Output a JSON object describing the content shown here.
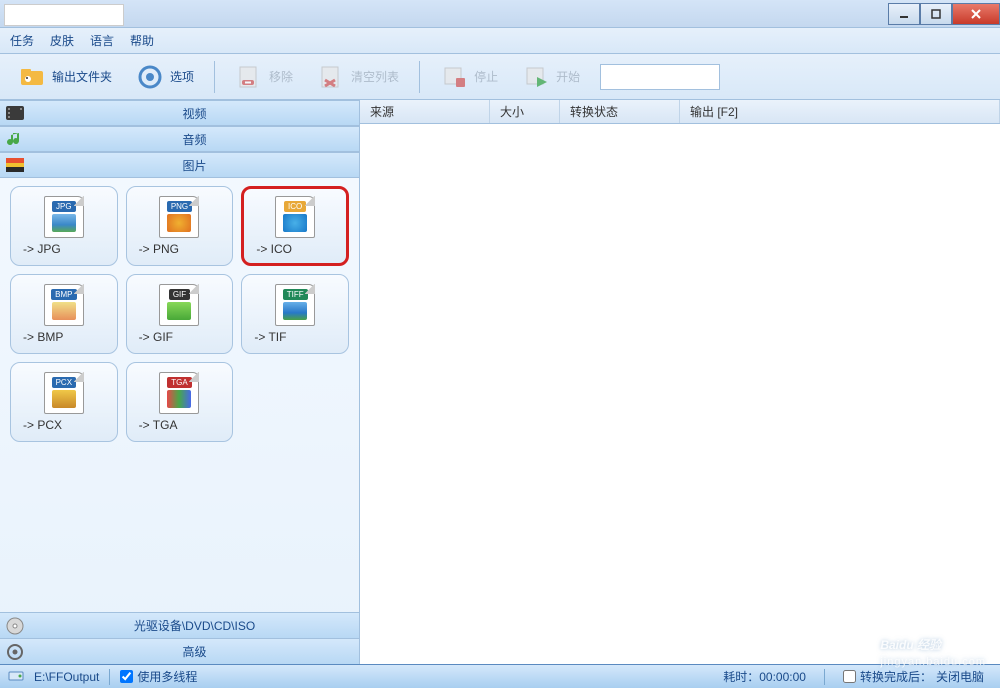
{
  "window": {
    "title": ""
  },
  "menu": {
    "task": "任务",
    "skin": "皮肤",
    "language": "语言",
    "help": "帮助"
  },
  "toolbar": {
    "output_folder": "输出文件夹",
    "options": "选项",
    "remove": "移除",
    "clear_list": "清空列表",
    "stop": "停止",
    "start": "开始"
  },
  "categories": {
    "video": "视频",
    "audio": "音频",
    "image": "图片"
  },
  "formats": [
    {
      "id": "jpg",
      "tag": "JPG",
      "tag_color": "#2a6ab0",
      "img_bg": "linear-gradient(#7ab8e8,#3a88c8 60%,#58a858)",
      "label": "-> JPG",
      "selected": false
    },
    {
      "id": "png",
      "tag": "PNG",
      "tag_color": "#2a6ab0",
      "img_bg": "radial-gradient(circle,#f0b030,#e07020)",
      "label": "-> PNG",
      "selected": false
    },
    {
      "id": "ico",
      "tag": "ICO",
      "tag_color": "#e8a838",
      "img_bg": "radial-gradient(circle,#48b0e8,#1878c8)",
      "label": "-> ICO",
      "selected": true
    },
    {
      "id": "bmp",
      "tag": "BMP",
      "tag_color": "#2a6ab0",
      "img_bg": "linear-gradient(#f0e088,#e8905a)",
      "label": "-> BMP",
      "selected": false
    },
    {
      "id": "gif",
      "tag": "GIF",
      "tag_color": "#333333",
      "img_bg": "linear-gradient(#88d858,#48a838)",
      "label": "-> GIF",
      "selected": false
    },
    {
      "id": "tif",
      "tag": "TIFF",
      "tag_color": "#208858",
      "img_bg": "linear-gradient(#68b0e8,#2878c8 60%,#48a048)",
      "label": "-> TIF",
      "selected": false
    },
    {
      "id": "pcx",
      "tag": "PCX",
      "tag_color": "#2a6ab0",
      "img_bg": "linear-gradient(#f0c848,#c88828)",
      "label": "-> PCX",
      "selected": false
    },
    {
      "id": "tga",
      "tag": "TGA",
      "tag_color": "#c03030",
      "img_bg": "linear-gradient(90deg,#e84848,#48a848,#4868e8)",
      "label": "-> TGA",
      "selected": false
    }
  ],
  "accordion": {
    "optical": "光驱设备\\DVD\\CD\\ISO",
    "advanced": "高级"
  },
  "table": {
    "col_source": "来源",
    "col_size": "大小",
    "col_status": "转换状态",
    "col_output": "输出 [F2]"
  },
  "statusbar": {
    "output_path": "E:\\FFOutput",
    "multithread_label": "使用多线程",
    "multithread_checked": true,
    "elapsed_label": "耗时：",
    "elapsed_value": "00:00:00",
    "after_done_label": "转换完成后：",
    "after_done_value": "关闭电脑",
    "after_done_checked": false
  },
  "watermark": {
    "main": "Baidu 经验",
    "sub": "jingyan.baidu.com"
  }
}
